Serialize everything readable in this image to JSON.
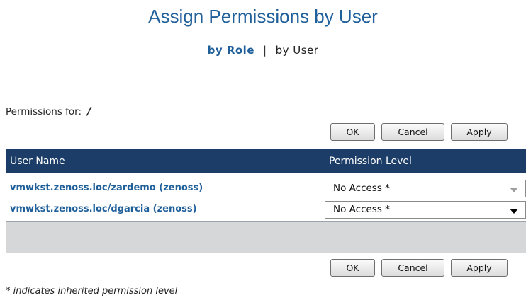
{
  "page": {
    "title": "Assign Permissions by User"
  },
  "view_switch": {
    "by_role": "by Role",
    "separator": "|",
    "by_user": "by User"
  },
  "permissions_for": {
    "label": "Permissions for:",
    "path": "/"
  },
  "buttons": {
    "ok": "OK",
    "cancel": "Cancel",
    "apply": "Apply"
  },
  "grid": {
    "headers": {
      "user_name": "User Name",
      "permission_level": "Permission Level"
    },
    "rows": [
      {
        "user": "vmwkst.zenoss.loc/zardemo (zenoss)",
        "level": "No Access *"
      },
      {
        "user": "vmwkst.zenoss.loc/dgarcia (zenoss)",
        "level": "No Access *"
      }
    ]
  },
  "note": "* indicates inherited permission level",
  "colors": {
    "title": "#1f5f9a",
    "header_bg": "#1c3d68",
    "footer_bg": "#d5d7d9",
    "link": "#1f5f9a"
  },
  "icons": {
    "dropdown": "chevron-down-icon"
  }
}
